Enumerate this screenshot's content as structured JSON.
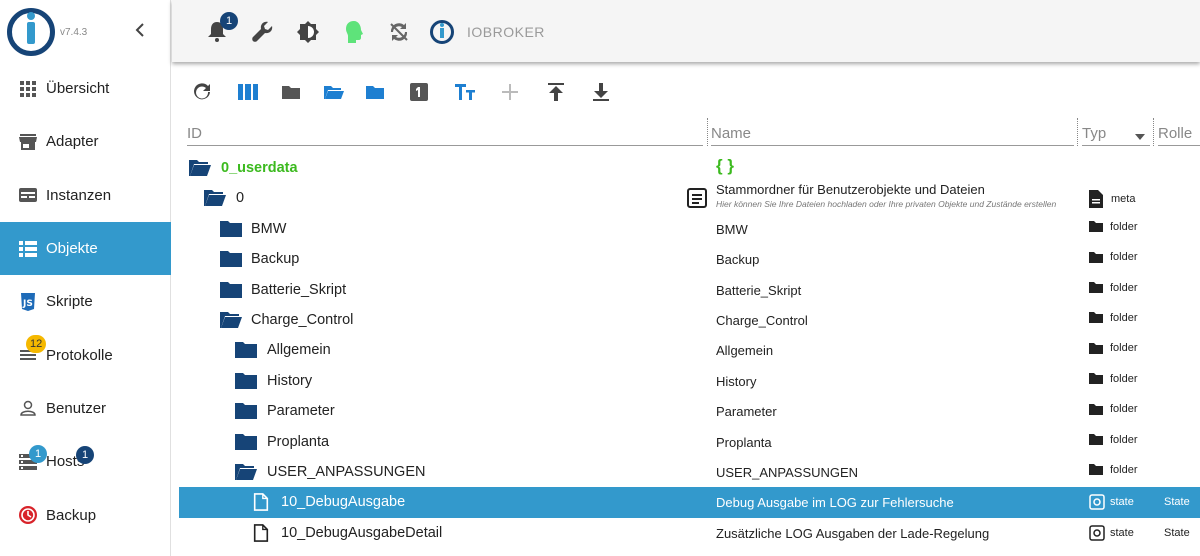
{
  "app": {
    "version": "v7.4.3",
    "brand": "IOBROKER",
    "notification_count": "1"
  },
  "sidebar": {
    "items": [
      {
        "label": "Übersicht",
        "icon": "grid-icon"
      },
      {
        "label": "Adapter",
        "icon": "store-icon"
      },
      {
        "label": "Instanzen",
        "icon": "instances-icon"
      },
      {
        "label": "Objekte",
        "icon": "list-icon",
        "active": true
      },
      {
        "label": "Skripte",
        "icon": "js-icon"
      },
      {
        "label": "Protokolle",
        "icon": "log-icon",
        "badge": "12"
      },
      {
        "label": "Benutzer",
        "icon": "user-icon"
      },
      {
        "label": "Hosts",
        "icon": "hosts-icon",
        "badge": "1",
        "badge2": "1"
      },
      {
        "label": "Backup",
        "icon": "backup-icon"
      }
    ]
  },
  "columns": {
    "id": "ID",
    "name": "Name",
    "typ": "Typ",
    "rolle": "Rolle"
  },
  "rows": [
    {
      "id": "0_userdata",
      "name": "{ }",
      "typ": "",
      "role": ""
    },
    {
      "id": "0",
      "name": "Stammordner für Benutzerobjekte und Dateien",
      "sub": "Hier können Sie Ihre Dateien hochladen oder Ihre privaten Objekte und Zustände erstellen",
      "typ": "meta",
      "role": ""
    },
    {
      "id": "BMW",
      "name": "BMW",
      "typ": "folder",
      "role": ""
    },
    {
      "id": "Backup",
      "name": "Backup",
      "typ": "folder",
      "role": ""
    },
    {
      "id": "Batterie_Skript",
      "name": "Batterie_Skript",
      "typ": "folder",
      "role": ""
    },
    {
      "id": "Charge_Control",
      "name": "Charge_Control",
      "typ": "folder",
      "role": ""
    },
    {
      "id": "Allgemein",
      "name": "Allgemein",
      "typ": "folder",
      "role": ""
    },
    {
      "id": "History",
      "name": "History",
      "typ": "folder",
      "role": ""
    },
    {
      "id": "Parameter",
      "name": "Parameter",
      "typ": "folder",
      "role": ""
    },
    {
      "id": "Proplanta",
      "name": "Proplanta",
      "typ": "folder",
      "role": ""
    },
    {
      "id": "USER_ANPASSUNGEN",
      "name": "USER_ANPASSUNGEN",
      "typ": "folder",
      "role": ""
    },
    {
      "id": "10_DebugAusgabe",
      "name": "Debug Ausgabe im LOG zur Fehlersuche",
      "typ": "state",
      "role": "State"
    },
    {
      "id": "10_DebugAusgabeDetail",
      "name": "Zusätzliche LOG Ausgaben der Lade-Regelung",
      "typ": "state",
      "role": "State"
    }
  ],
  "colors": {
    "accent": "#3399cc",
    "brand_dark": "#164477",
    "folder": "#164477",
    "userdata_green": "#3cba1f"
  }
}
